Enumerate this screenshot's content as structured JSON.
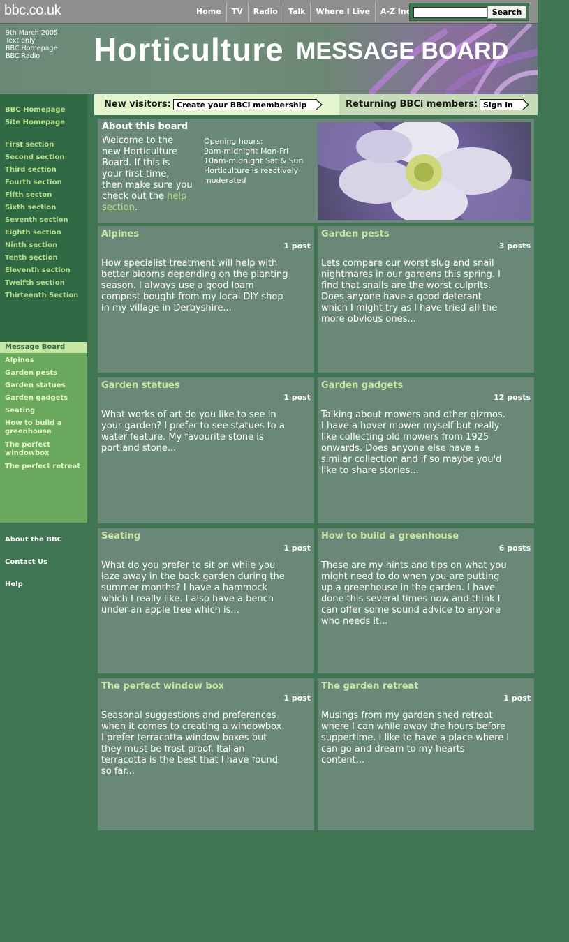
{
  "header": {
    "logo": "bbc.co.uk",
    "nav": [
      "Home",
      "TV",
      "Radio",
      "Talk",
      "Where I Live",
      "A-Z Index"
    ],
    "search_button": "Search",
    "search_value": ""
  },
  "banner": {
    "date": "9th March 2005",
    "text_only": "Text only",
    "bbc_homepage": "BBC Homepage",
    "bbc_radio": "BBC Radio",
    "title": "Horticulture",
    "subtitle": "MESSAGE BOARD"
  },
  "sidebar": {
    "top_links": [
      "BBC Homepage",
      "Site Homepage"
    ],
    "sections": [
      "First section",
      "Second section",
      "Third section",
      "Fourth section",
      "Fifth secton",
      "Sixth section",
      "Seventh section",
      "Eighth section",
      "Ninth section",
      "Tenth section",
      "Eleventh section",
      "Twelfth section",
      "Thirteenth Section"
    ],
    "board_label": "Message Board",
    "board_links": [
      "Alpines",
      "Garden pests",
      "Garden statues",
      "Garden gadgets",
      "Seating",
      "How to build a greenhouse",
      "The perfect windowbox",
      "The perfect retreat"
    ],
    "footer_links": [
      "About the BBC",
      "Contact Us",
      "Help"
    ]
  },
  "signin": {
    "new_label": "New visitors:",
    "new_button": "Create your BBCi membership",
    "returning_label": "Returning BBCi members:",
    "returning_button": "Sign in"
  },
  "about": {
    "title": "About this board",
    "text": "Welcome to the new Horticulture Board. If this is your first time, then make sure you check out the",
    "link": "help section",
    "link_suffix": ".",
    "hours_title": "Opening hours:",
    "hours_1": "9am-midnight Mon-Fri",
    "hours_2": "10am-midnight Sat & Sun",
    "moderation": "Horticulture is reactively moderated"
  },
  "cards": [
    {
      "title": "Alpines",
      "count": "1 post",
      "body": "How specialist treatment will help with better blooms depending on the planting season. I always use a good loam compost bought from my local DIY shop in my village in Derbyshire..."
    },
    {
      "title": "Garden pests",
      "count": "3 posts",
      "body": "Lets compare our worst slug and snail nightmares in our gardens this spring. I find that snails are the worst culprits. Does anyone have a good deterant which I might try as I have tried all the more obvious ones..."
    },
    {
      "title": "Garden statues",
      "count": "1 post",
      "body": "What works of art do you like to see in your garden? I prefer to see statues to a water feature. My favourite stone is portland stone..."
    },
    {
      "title": "Garden gadgets",
      "count": "12 posts",
      "body": "Talking about mowers and other gizmos. I have a hover mower myself but really like collecting old mowers from 1925 onwards. Does anyone else have a similar collection and if so maybe you'd like to share stories..."
    },
    {
      "title": "Seating",
      "count": "1 post",
      "body": "What do you prefer to sit on while you laze away in the back garden during the summer months? I have a hammock which I really like. I also have a bench under an apple tree which is..."
    },
    {
      "title": "How to build a greenhouse",
      "count": "6 posts",
      "body": "These are my hints and tips on what you might need to do when you are putting up a greenhouse in the garden. I have done this several times now and think I can offer some sound advice to anyone who needs it..."
    },
    {
      "title": "The perfect window box",
      "count": "1 post",
      "body": "Seasonal suggestions and preferences when it comes to creating a windowbox. I prefer terracotta window boxes but they must be frost proof. Italian terracotta is the best that I have found so far..."
    },
    {
      "title": "The garden retreat",
      "count": "1 post",
      "body": "Musings from my garden shed retreat where I can while away the hours before suppertime. I like to have a place where I can go and dream to my hearts content..."
    }
  ]
}
